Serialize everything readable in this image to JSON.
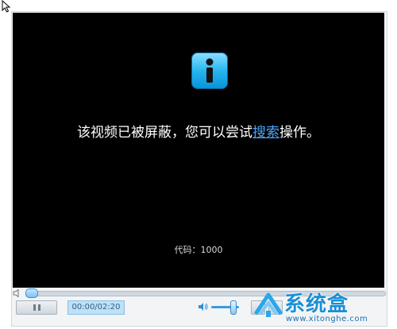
{
  "player": {
    "message_prefix": "该视频已被屏蔽，您可以尝试",
    "message_link": "搜索",
    "message_suffix": "操作。",
    "code_text": "代码：1000",
    "time_text": "00:00/02:20",
    "progress_fraction": 0.0,
    "volume_fraction": 0.75
  },
  "watermark": {
    "title": "系统盒",
    "url": "www.xitonghe.com"
  },
  "icons": {
    "info": "info-icon",
    "cursor": "cursor-icon",
    "pause": "pause-icon",
    "volume": "speaker-icon"
  },
  "colors": {
    "video_bg": "#000000",
    "link": "#4ca7ff",
    "accent": "#1a8fd6"
  }
}
